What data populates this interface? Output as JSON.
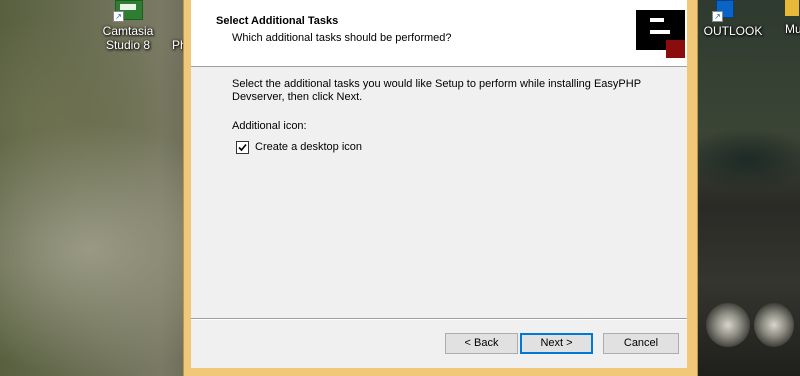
{
  "desktop": {
    "icons": [
      {
        "label_line1": "Camtasia",
        "label_line2": "Studio 8"
      },
      {
        "label_line1": "Ph",
        "label_line2": ""
      },
      {
        "label_line1": "OUTLOOK",
        "label_line2": ""
      },
      {
        "label_line1": "Mu",
        "label_line2": ""
      }
    ]
  },
  "wizard": {
    "title": "Select Additional Tasks",
    "subtitle": "Which additional tasks should be performed?",
    "description": "Select the additional tasks you would like Setup to perform while installing EasyPHP Devserver, then click Next.",
    "group_label": "Additional icon:",
    "task_label": "Create a desktop icon",
    "task_checked": true,
    "buttons": {
      "back": "< Back",
      "next": "Next >",
      "cancel": "Cancel"
    },
    "colors": {
      "frame": "#f0c878",
      "logo_accent": "#8b0c0c",
      "logo_dark": "#000000",
      "default_button_border": "#0078d7"
    }
  }
}
